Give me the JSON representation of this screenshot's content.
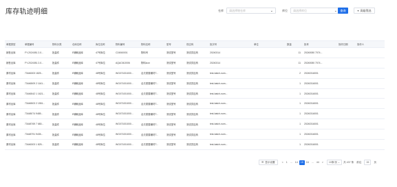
{
  "page": {
    "title": "库存轨迹明细"
  },
  "filters": {
    "warehouse": {
      "label": "仓库",
      "placeholder": "请选择物仓库"
    },
    "location": {
      "label": "库位",
      "placeholder": "请选择库位"
    },
    "query_label": "查询",
    "advanced_label": "高级筛选"
  },
  "table": {
    "columns": [
      "单据类型",
      "单据编号",
      "物料分类",
      "仓库名称",
      "库位名称",
      "物料编号",
      "物料名称",
      "型号",
      "供应商",
      "批次号",
      "单位",
      "数量",
      "批号",
      "操作日期",
      "操作人"
    ],
    "rows": [
      [
        "销售出库",
        "FY-2024081 2-0...",
        "批量件",
        "E辅耗品库",
        "47号库位",
        "C24060001",
        "物料号",
        "测试型号",
        "测试供应商",
        "20240314",
        "",
        "11",
        "20240080 7074...",
        "",
        ""
      ],
      [
        "销售出库",
        "FY-2024081 2-0...",
        "批量件",
        "E辅耗品库",
        "47号库位",
        "AQAC60J006",
        "物料icon",
        "测试型号",
        "测试供应商",
        "20240314",
        "",
        "11",
        "20240080 7074...",
        "",
        ""
      ],
      [
        "原材出库",
        "73446303 1825...",
        "批量件",
        "E辅耗品库",
        "48号库位",
        "WG071001000...",
        "合贝类属辅材T...",
        "测试型号",
        "测试供应商",
        "test-batch-num...",
        "",
        "2",
        "20240316001",
        "",
        ""
      ],
      [
        "原材出库",
        "73446509 2 1161...",
        "批量件",
        "E辅耗品库",
        "48号库位",
        "WG071001000...",
        "合贝类属辅材T...",
        "测试型号",
        "测试供应商",
        "test-batch-num...",
        "",
        "1",
        "20240316001",
        "",
        ""
      ],
      [
        "原材出库",
        "73446542 1 1621...",
        "批量件",
        "E辅耗品库",
        "48号库位",
        "WG071001000...",
        "合贝类属辅材T...",
        "测试型号",
        "测试供应商",
        "test-batch-num...",
        "",
        "1",
        "20240316001",
        "",
        ""
      ],
      [
        "原材出库",
        "73446503 2 1551...",
        "批量件",
        "E辅耗品库",
        "48号库位",
        "WG071001000...",
        "合贝类属辅材T...",
        "测试型号",
        "测试供应商",
        "test-batch-num...",
        "",
        "1",
        "20240316001",
        "",
        ""
      ],
      [
        "原材出库",
        "73448074 9485...",
        "批量件",
        "E辅耗品库",
        "48号库位",
        "WG071001000...",
        "合贝类属辅材T...",
        "测试型号",
        "测试供应商",
        "test-batch-num...",
        "",
        "1",
        "20240316001",
        "",
        ""
      ],
      [
        "原材出库",
        "73448769 7 680...",
        "批量件",
        "E辅耗品库",
        "48号库位",
        "WG071001000...",
        "合贝类属辅材T...",
        "测试型号",
        "测试供应商",
        "test-batch-num...",
        "",
        "1",
        "20240316001",
        "",
        ""
      ],
      [
        "原材出库",
        "73448791 9435...",
        "批量件",
        "E辅耗品库",
        "48号库位",
        "WG071001000...",
        "合贝类属辅材T...",
        "测试型号",
        "测试供应商",
        "test-batch-num...",
        "",
        "1",
        "20240316001",
        "",
        ""
      ],
      [
        "原材出库",
        "73446303 1 825...",
        "批量件",
        "E辅耗品库",
        "48号库位",
        "WG071001000...",
        "合贝类属辅材T...",
        "测试型号",
        "测试供应商",
        "test-batch-num...",
        "",
        "1",
        "20240316001",
        "",
        ""
      ]
    ]
  },
  "pagination": {
    "settings_label": "显示设置",
    "prev": "<",
    "pages": [
      "1",
      "...",
      "14",
      "15",
      "16",
      "...",
      "44"
    ],
    "current": "15",
    "next": ">",
    "page_size": "10条/页",
    "total": "共 437 条",
    "jump_prefix": "前往",
    "jump_value": "15",
    "jump_suffix": "页"
  },
  "colors": {
    "primary": "#1f6fe8",
    "header_bg": "#f5f7fa",
    "border": "#ebeef5"
  },
  "icons": {
    "chevron": "chevron-down-icon",
    "filter": "filter-icon",
    "settings": "settings-icon"
  }
}
